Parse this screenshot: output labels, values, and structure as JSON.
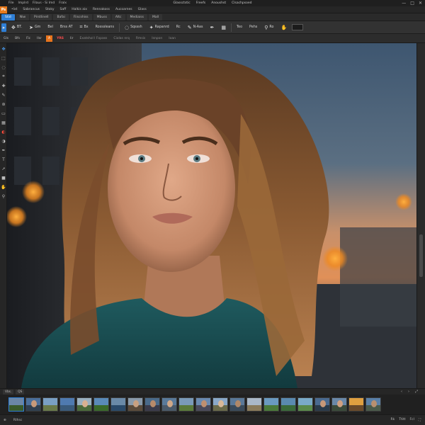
{
  "titlebar": {
    "menu": [
      "File",
      "Implrd",
      "Filaus - Si Imd",
      "Fralx"
    ],
    "title_parts": [
      "Glassctstic",
      "Freefs",
      "Anoushst",
      "Clsachpsoed"
    ],
    "controls": [
      "—",
      "□",
      "✕"
    ]
  },
  "menubar": {
    "logo": "Ps",
    "items": [
      "•Ixt",
      "Sabrancus",
      "Stoky",
      "Saff",
      "Halkis aix",
      "Rennakoss",
      "Aucoarnes",
      "Glass"
    ]
  },
  "tabs": [
    "Stid",
    "Niw",
    "Pirstlinell",
    "Bafai",
    "Fiiscshiss",
    "Mbuss",
    "Altc",
    "Mediaiss",
    "Mall"
  ],
  "options": [
    {
      "label": "BT.",
      "icon": "move-icon"
    },
    {
      "label": "Gm",
      "icon": "arrow-icon"
    },
    {
      "label": "Bel",
      "icon": ""
    },
    {
      "label": "Brss AT",
      "icon": ""
    },
    {
      "label": "Bx",
      "icon": "crop-icon"
    },
    {
      "label": "Rosssleans",
      "icon": ""
    },
    {
      "label": "Sqsssh",
      "icon": "lasso-icon"
    },
    {
      "label": "Rapanrd",
      "icon": "magic-wand-icon"
    },
    {
      "label": "Rc",
      "icon": ""
    },
    {
      "label": "N-Aas",
      "icon": "brush-icon"
    },
    {
      "label": "",
      "icon": "pen-icon"
    },
    {
      "label": "",
      "icon": "gradient-icon"
    },
    {
      "label": "Teo",
      "icon": ""
    },
    {
      "label": "Pehs",
      "icon": ""
    },
    {
      "label": "Ro",
      "icon": "eyedropper-icon"
    },
    {
      "label": "",
      "icon": "hand-icon"
    }
  ],
  "doc_tabs": {
    "items": [
      {
        "label": "Gls",
        "style": "normal"
      },
      {
        "label": "Bfs",
        "style": "normal"
      },
      {
        "label": "Fic",
        "style": "normal"
      },
      {
        "label": "IIsr",
        "style": "normal"
      },
      {
        "label": "A",
        "style": "orange"
      },
      {
        "label": "YRS",
        "style": "red"
      },
      {
        "label": "Iir",
        "style": "normal"
      },
      {
        "label": "Exatshol I Fopass",
        "style": "file"
      },
      {
        "label": "Ciolas nrq",
        "style": "file"
      },
      {
        "label": "Rmsis",
        "style": "file"
      },
      {
        "label": "Isnpon",
        "style": "file"
      },
      {
        "label": "Ioan",
        "style": "file"
      }
    ]
  },
  "toolbox": {
    "tools": [
      "move-icon",
      "marquee-icon",
      "lasso-icon",
      "crop-icon",
      "heal-icon",
      "brush-icon",
      "stamp-icon",
      "eraser-icon",
      "gradient-icon",
      "blur-icon",
      "dodge-icon",
      "pen-icon",
      "type-icon",
      "path-icon",
      "shape-icon",
      "hand-icon",
      "zoom-icon"
    ]
  },
  "film_tabs": [
    "Vbs.",
    "QS"
  ],
  "film_controls": [
    "‹",
    "›",
    "⤢"
  ],
  "filmstrip": {
    "thumbs": [
      {
        "sky": "#6b86a6",
        "ground": "#3a5a2a",
        "face": ""
      },
      {
        "sky": "#4b6f9a",
        "ground": "#2f3f4f",
        "face": "#c79a7a"
      },
      {
        "sky": "#7aa0c4",
        "ground": "#6a7a4a",
        "face": ""
      },
      {
        "sky": "#4f7ab0",
        "ground": "#3a5a7a",
        "face": ""
      },
      {
        "sky": "#9ab0c0",
        "ground": "#4a6a3a",
        "face": "#d8b090"
      },
      {
        "sky": "#5a8ab8",
        "ground": "#3a6a2a",
        "face": ""
      },
      {
        "sky": "#6a8aa8",
        "ground": "#2a4a6a",
        "face": ""
      },
      {
        "sky": "#8a9aaa",
        "ground": "#5a4a3a",
        "face": "#c8a080"
      },
      {
        "sky": "#4a6a8a",
        "ground": "#3a3a4a",
        "face": "#b88a6a"
      },
      {
        "sky": "#5a7a9a",
        "ground": "#4a5a6a",
        "face": "#d0a888"
      },
      {
        "sky": "#7a9ab8",
        "ground": "#5a7a3a",
        "face": ""
      },
      {
        "sky": "#6a8ab0",
        "ground": "#4a4a5a",
        "face": "#c09070"
      },
      {
        "sky": "#8aa8c8",
        "ground": "#6a6a4a",
        "face": "#d8b898"
      },
      {
        "sky": "#5a7898",
        "ground": "#3a4a5a",
        "face": "#b08868"
      },
      {
        "sky": "#aab8c8",
        "ground": "#8a7a5a",
        "face": ""
      },
      {
        "sky": "#6a9ac0",
        "ground": "#4a7a3a",
        "face": ""
      },
      {
        "sky": "#5a8ab0",
        "ground": "#3a6a3a",
        "face": ""
      },
      {
        "sky": "#7aaac8",
        "ground": "#5a8a4a",
        "face": ""
      },
      {
        "sky": "#4a6a90",
        "ground": "#2a3a4a",
        "face": "#c89878"
      },
      {
        "sky": "#6a88a8",
        "ground": "#3a4a3a",
        "face": "#d0a080"
      },
      {
        "sky": "#e0a040",
        "ground": "#6a4a2a",
        "face": ""
      },
      {
        "sky": "#5a80a8",
        "ground": "#4a5a4a",
        "face": "#b89070"
      }
    ]
  },
  "statusbar": {
    "left": [
      "⊕",
      "Rthsc"
    ],
    "right": [
      "Rk",
      "Ttitt",
      "Fcl",
      "⛶"
    ]
  }
}
